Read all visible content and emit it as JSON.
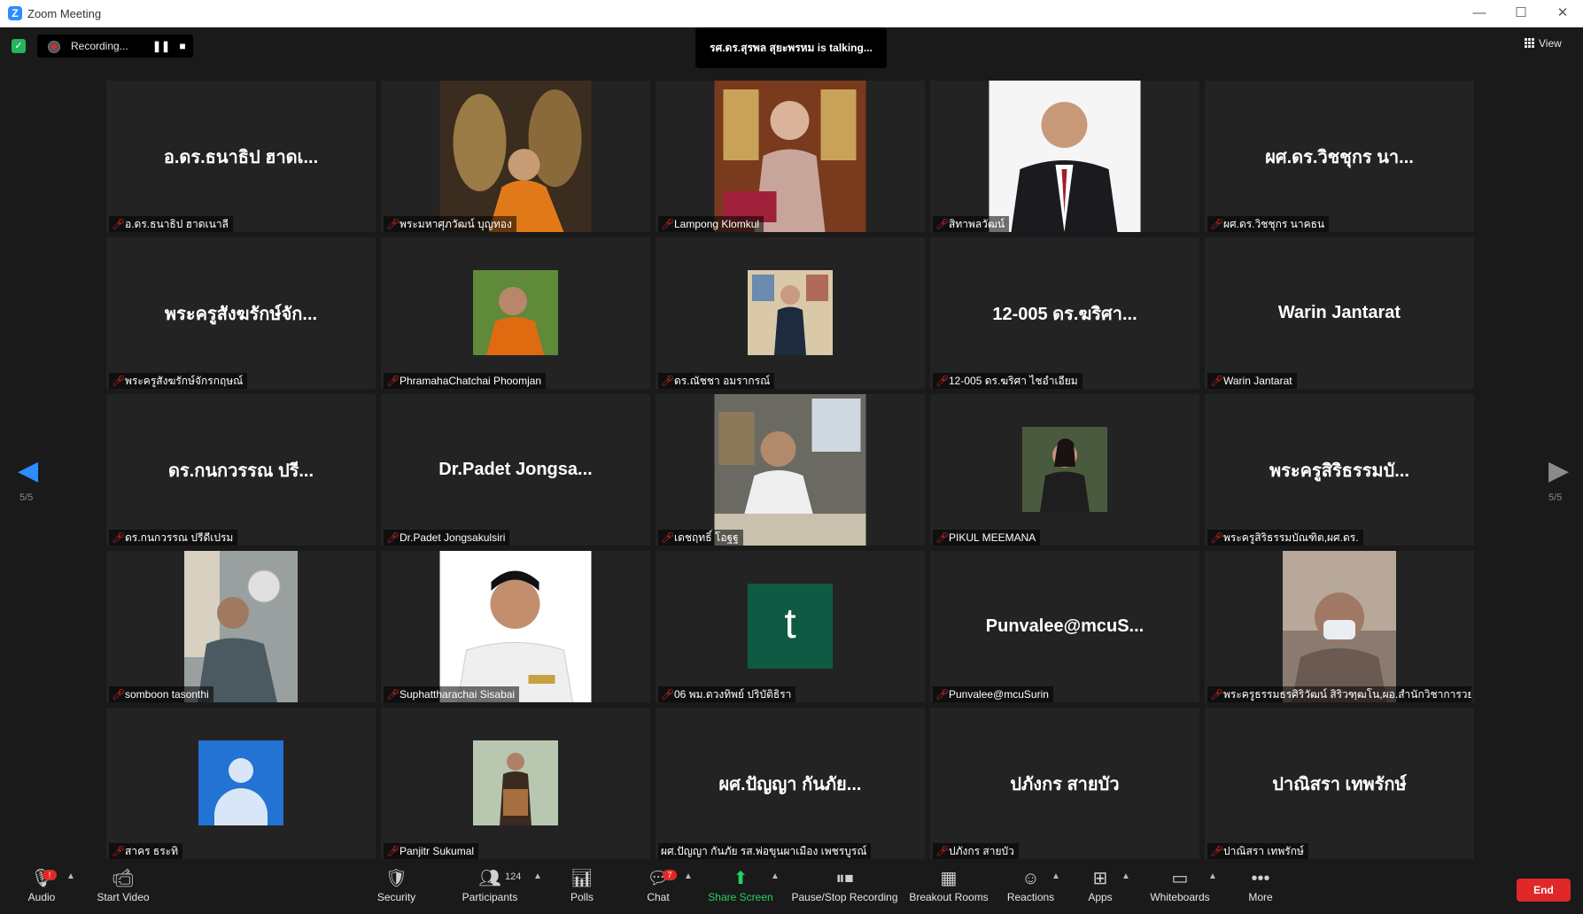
{
  "window": {
    "title": "Zoom Meeting",
    "minimize": "—",
    "maximize": "☐",
    "close": "✕"
  },
  "topbar": {
    "recording_label": "Recording...",
    "talking_text": "รศ.ดร.สุรพล สุยะพรหม is  talking...",
    "view_label": "View"
  },
  "pagination": {
    "left": "5/5",
    "right": "5/5"
  },
  "tiles": [
    {
      "display": "อ.ดร.ธนาธิป ฮาดเ...",
      "name": "อ.ดร.ธนาธิป ฮาดเนาลี"
    },
    {
      "display": "",
      "name": "พระมหาศุภวัฒน์ บุญทอง"
    },
    {
      "display": "",
      "name": "Lampong Klomkul"
    },
    {
      "display": "",
      "name": "สิทาพลวัฒน์"
    },
    {
      "display": "ผศ.ดร.วิชชุกร นา...",
      "name": "ผศ.ดร.วิชชุกร นาคธน"
    },
    {
      "display": "พระครูสังฆรักษ์จัก...",
      "name": "พระครูสังฆรักษ์จักรกฤษณ์"
    },
    {
      "display": "",
      "name": "PhramahaChatchai Phoomjan"
    },
    {
      "display": "",
      "name": "ดร.ณัชชา อมรากรณ์"
    },
    {
      "display": "12-005 ดร.ฆริศา...",
      "name": "12-005 ดร.ฆริศา ไชอำเอียม"
    },
    {
      "display": "Warin Jantarat",
      "name": "Warin Jantarat"
    },
    {
      "display": "ดร.กนกวรรณ ปรี...",
      "name": "ดร.กนกวรรณ ปรีดีเปรม"
    },
    {
      "display": "Dr.Padet Jongsa...",
      "name": "Dr.Padet Jongsakulsiri"
    },
    {
      "display": "",
      "name": "เดชฤทธิ์ โอฐฐ"
    },
    {
      "display": "",
      "name": "PIKUL MEEMANA"
    },
    {
      "display": "พระครูสิริธรรมบั...",
      "name": "พระครูสิริธรรมบัณฑิต,ผศ.ดร."
    },
    {
      "display": "",
      "name": "somboon tasonthi"
    },
    {
      "display": "",
      "name": "Suphattharachai Sisabai"
    },
    {
      "display": "t",
      "name": "06 พม.ดวงทิพย์ ปริบัติธิรา"
    },
    {
      "display": "Punvalee@mcuS...",
      "name": "Punvalee@mcuSurin"
    },
    {
      "display": "",
      "name": "พระครูธรรมธรศิริวัฒน์ สิริวฑฺฒโน,ผอ.สำนักวิชาการวย..."
    },
    {
      "display": "",
      "name": "สาคร ธระทิ"
    },
    {
      "display": "",
      "name": "Panjitr Sukumal"
    },
    {
      "display": "ผศ.ปัญญา กันภัย...",
      "name": "ผศ.ปัญญา กันภัย รส.พ่อขุนผาเมือง เพชรบูรณ์"
    },
    {
      "display": "ปภังกร สายบัว",
      "name": "ปภังกร สายบัว"
    },
    {
      "display": "ปาณิสรา เทพรักษ์",
      "name": "ปาณิสรา เทพรักษ์"
    }
  ],
  "toolbar": {
    "audio": "Audio",
    "audio_badge": "!",
    "start_video": "Start Video",
    "security": "Security",
    "participants": "Participants",
    "participants_count": "124",
    "polls": "Polls",
    "chat": "Chat",
    "chat_badge": "7",
    "share_screen": "Share Screen",
    "pause_stop_recording": "Pause/Stop Recording",
    "breakout_rooms": "Breakout Rooms",
    "reactions": "Reactions",
    "apps": "Apps",
    "whiteboards": "Whiteboards",
    "more": "More",
    "end": "End"
  },
  "colors": {
    "accent": "#2d8cff",
    "green": "#23d160",
    "end": "#e02828",
    "tile": "#232323"
  }
}
